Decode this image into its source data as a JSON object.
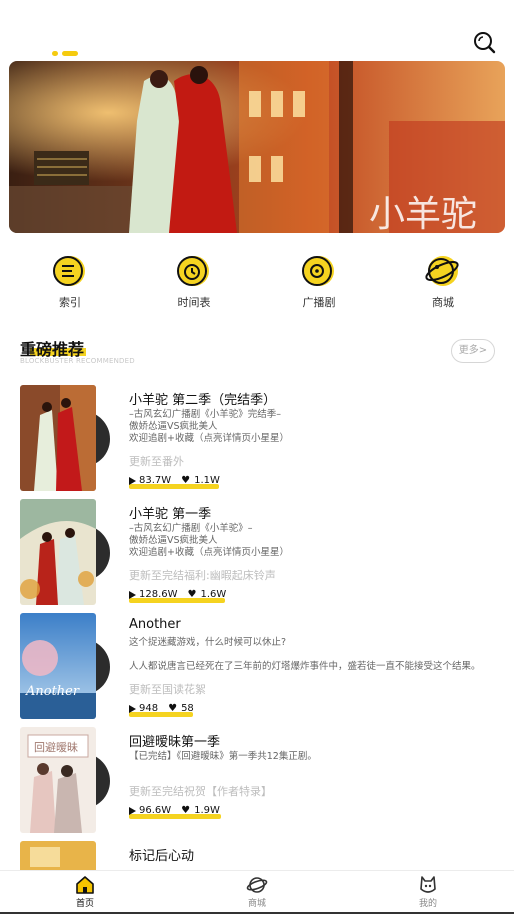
{
  "header": {
    "search_icon": "search-icon"
  },
  "banner": {
    "carousel_pages": 2,
    "active_page": 2,
    "watermark": "小羊驼"
  },
  "quick_nav": [
    {
      "label": "索引",
      "icon": "index-icon"
    },
    {
      "label": "时间表",
      "icon": "clock-icon"
    },
    {
      "label": "广播剧",
      "icon": "disc-icon"
    },
    {
      "label": "商城",
      "icon": "planet-icon"
    }
  ],
  "section": {
    "title": "重磅推荐",
    "subtitle": "BLOCKBUSTER RECOMMENDED",
    "more_label": "更多>"
  },
  "items": [
    {
      "title": "小羊驼 第二季（完结季）",
      "desc": "–古风玄幻广播剧《小羊驼》完结季–\n傲娇怂逼VS疯批美人\n欢迎追剧+收藏（点亮详情页小星星）",
      "update": "更新至番外",
      "plays": "83.7W",
      "likes": "1.1W"
    },
    {
      "title": "小羊驼 第一季",
      "desc": "–古风玄幻广播剧《小羊驼》–\n傲娇怂逼VS疯批美人\n欢迎追剧+收藏（点亮详情页小星星）",
      "update": "更新至完结福利:幽暇起床铃声",
      "plays": "128.6W",
      "likes": "1.6W"
    },
    {
      "title": "Another",
      "desc": "这个捉迷藏游戏，什么时候可以休止?\n\n人人都说唐言已经死在了三年前的灯塔爆炸事件中，盛若徒一直不能接受这个结果。",
      "update": "更新至国读花絮",
      "plays": "948",
      "likes": "58"
    },
    {
      "title": "回避暧昧第一季",
      "desc": "【已完结】《回避暧昧》第一季共12集正剧。",
      "update": "更新至完结祝贺【作者特录】",
      "plays": "96.6W",
      "likes": "1.9W"
    },
    {
      "title": "标记后心动"
    }
  ],
  "tabs": [
    {
      "label": "首页",
      "icon": "home-icon",
      "active": true
    },
    {
      "label": "商城",
      "icon": "planet-icon",
      "active": false
    },
    {
      "label": "我的",
      "icon": "profile-icon",
      "active": false
    }
  ],
  "colors": {
    "accent": "#f5d320",
    "text": "#111111",
    "muted": "#bdbdbd"
  }
}
